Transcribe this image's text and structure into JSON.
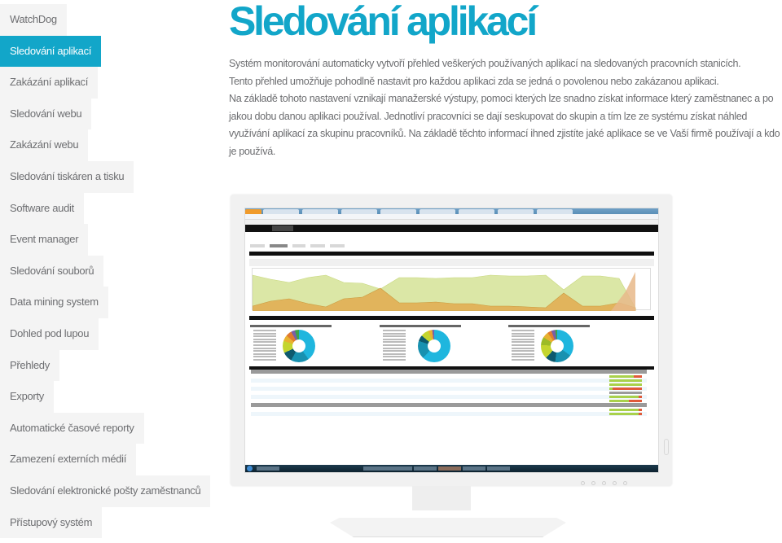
{
  "sidebar": {
    "items": [
      {
        "label": "WatchDog",
        "active": false
      },
      {
        "label": "Sledování aplikací",
        "active": true
      },
      {
        "label": "Zakázání aplikací",
        "active": false
      },
      {
        "label": "Sledování webu",
        "active": false
      },
      {
        "label": "Zakázání webu",
        "active": false
      },
      {
        "label": "Sledování tiskáren a tisku",
        "active": false
      },
      {
        "label": "Software audit",
        "active": false
      },
      {
        "label": "Event manager",
        "active": false
      },
      {
        "label": "Sledování souborů",
        "active": false
      },
      {
        "label": "Data mining system",
        "active": false
      },
      {
        "label": "Dohled pod lupou",
        "active": false
      },
      {
        "label": "Přehledy",
        "active": false
      },
      {
        "label": "Exporty",
        "active": false
      },
      {
        "label": "Automatické časové reporty",
        "active": false
      },
      {
        "label": "Zamezení externích médií",
        "active": false
      },
      {
        "label": "Sledování elektronické pošty zaměstnanců",
        "active": false
      },
      {
        "label": "Přístupový systém",
        "active": false
      }
    ]
  },
  "main": {
    "title": "Sledování aplikací",
    "paragraphs": [
      "Systém monitorování automaticky vytvoří přehled veškerých používaných aplikací na sledovaných pracovních stanicích.",
      "Tento přehled umožňuje pohodlně nastavit pro každou aplikaci zda se jedná o povolenou nebo zakázanou aplikaci.",
      "Na základě tohoto nastavení vznikají manažerské výstupy, pomoci kterých lze snadno získat informace který zaměstnanec a po jakou dobu danou aplikaci používal. Jednotliví pracovníci se dají seskupovat do skupin a tím lze ze systému získat náhled využívání aplikací za skupinu pracovníků. Na základě těchto informací ihned zjistíte jaké aplikace se ve Vaší firmě používají a kdo je používá."
    ],
    "screenshot": {
      "alt": "monitor-with-application-monitoring-dashboard",
      "colors": {
        "accent": "#12a6c9",
        "area_green": "#d6e39a",
        "area_orange": "#e3b25c",
        "bar_ok": "#a9d14b",
        "bar_bad": "#e05a3a"
      }
    }
  },
  "colors": {
    "accent": "#12a6c9",
    "text": "#6d6e71",
    "nav_bg": "#f4f4f4"
  }
}
